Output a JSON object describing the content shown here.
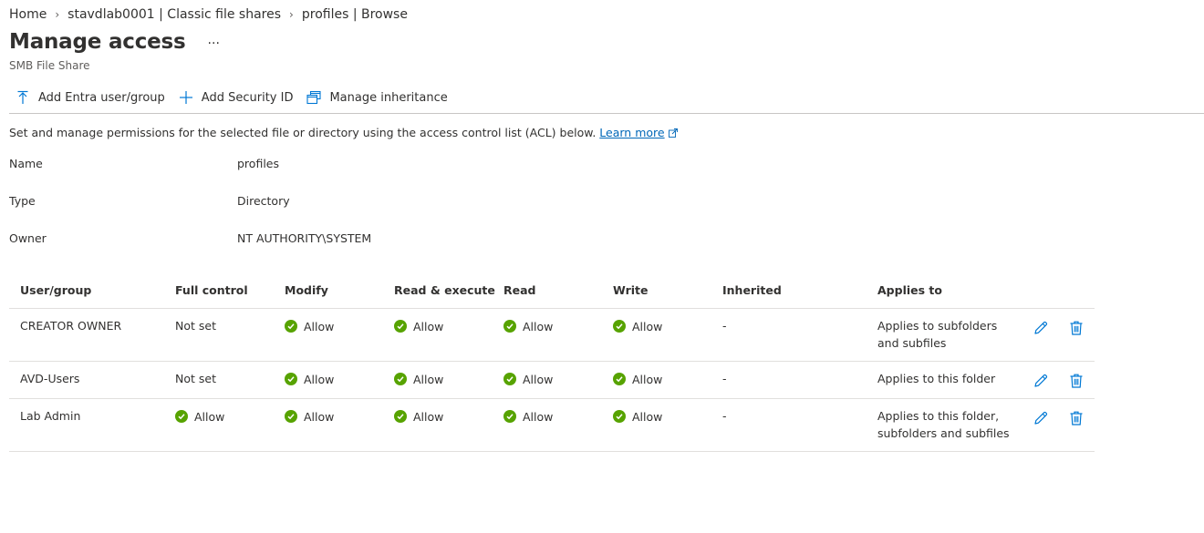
{
  "breadcrumb": {
    "items": [
      "Home",
      "stavdlab0001 | Classic file shares",
      "profiles | Browse"
    ],
    "separator": "›"
  },
  "header": {
    "title": "Manage access",
    "more_label": "...",
    "subtitle": "SMB File Share"
  },
  "toolbar": {
    "add_entra_label": "Add Entra user/group",
    "add_sid_label": "Add Security ID",
    "manage_inheritance_label": "Manage inheritance"
  },
  "description": {
    "text": "Set and manage permissions for the selected file or directory using the access control list (ACL) below.",
    "link": "Learn more"
  },
  "properties": {
    "name_label": "Name",
    "name_value": "profiles",
    "type_label": "Type",
    "type_value": "Directory",
    "owner_label": "Owner",
    "owner_value": "NT AUTHORITY\\SYSTEM"
  },
  "table": {
    "columns": [
      "User/group",
      "Full control",
      "Modify",
      "Read & execute",
      "Read",
      "Write",
      "Inherited",
      "Applies to"
    ],
    "rows": [
      {
        "user": "CREATOR OWNER",
        "full_control": "Not set",
        "modify": "Allow",
        "read_execute": "Allow",
        "read": "Allow",
        "write": "Allow",
        "inherited": "-",
        "applies_to": "Applies to subfolders and subfiles"
      },
      {
        "user": "AVD-Users",
        "full_control": "Not set",
        "modify": "Allow",
        "read_execute": "Allow",
        "read": "Allow",
        "write": "Allow",
        "inherited": "-",
        "applies_to": "Applies to this folder"
      },
      {
        "user": "Lab Admin",
        "full_control": "Allow",
        "modify": "Allow",
        "read_execute": "Allow",
        "read": "Allow",
        "write": "Allow",
        "inherited": "-",
        "applies_to": "Applies to this folder, subfolders and subfiles"
      }
    ]
  },
  "colors": {
    "accent": "#0078d4",
    "allow_green": "#57a300",
    "link": "#0067b8"
  },
  "icons": {
    "add_entra": "upload-arrow-icon",
    "add_sid": "plus-icon",
    "manage_inheritance": "windows-stack-icon",
    "edit": "pencil-icon",
    "delete": "trash-icon",
    "allow": "check-circle-icon",
    "external": "external-link-icon"
  }
}
